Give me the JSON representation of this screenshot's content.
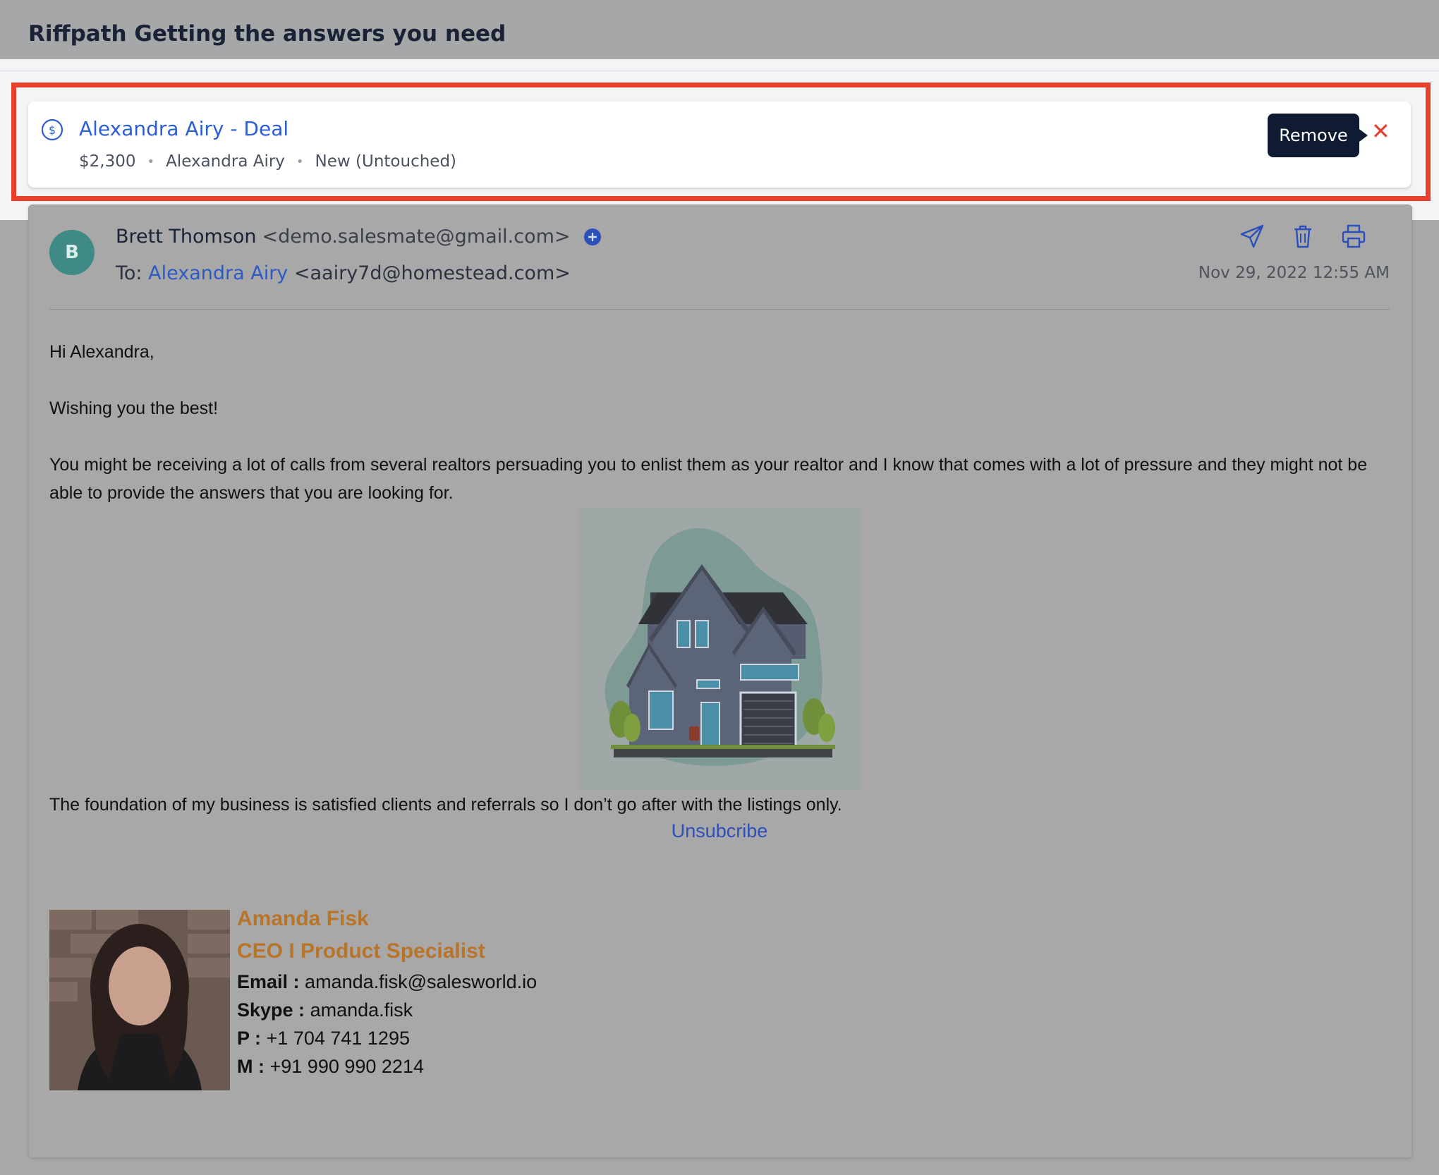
{
  "page": {
    "title": "Riffpath Getting the answers you need"
  },
  "deal": {
    "title": "Alexandra Airy - Deal",
    "amount": "$2,300",
    "contact": "Alexandra Airy",
    "status": "New (Untouched)",
    "remove_tooltip": "Remove",
    "close_glyph": "✕"
  },
  "email": {
    "avatar_initial": "B",
    "from_name": "Brett Thomson",
    "from_email": "<demo.salesmate@gmail.com>",
    "to_label": "To:",
    "to_name": "Alexandra Airy",
    "to_email": "<aairy7d@homestead.com>",
    "date": "Nov 29, 2022 12:55 AM",
    "greeting": "Hi Alexandra,",
    "line1": "Wishing you the best!",
    "paragraph": "You might be receiving a lot of calls from several realtors persuading you to enlist them as your realtor and I know that comes with a lot of pressure and they might not be able to provide the answers that you are looking for.",
    "closing": "The foundation of my business is satisfied clients and referrals so I don’t go after with the listings only.",
    "unsubscribe": "Unsubcribe"
  },
  "signature": {
    "name": "Amanda Fisk",
    "role": "CEO I Product Specialist",
    "email_label": "Email :",
    "email_value": "amanda.fisk@salesworld.io",
    "skype_label": "Skype :",
    "skype_value": "amanda.fisk",
    "p_label": "P :",
    "p_value": "+1 704 741 1295",
    "m_label": "M :",
    "m_value": "+91 990 990 2214"
  },
  "icons": {
    "deal": "dollar-circle-icon",
    "add": "plus-circle-icon",
    "forward": "send-icon",
    "delete": "trash-icon",
    "print": "printer-icon"
  },
  "colors": {
    "accent_blue": "#2d5ed6",
    "highlight_red": "#e8402c",
    "tooltip_bg": "#0f1a33",
    "signature_orange": "#b87428",
    "avatar_bg": "#3f8a84"
  }
}
